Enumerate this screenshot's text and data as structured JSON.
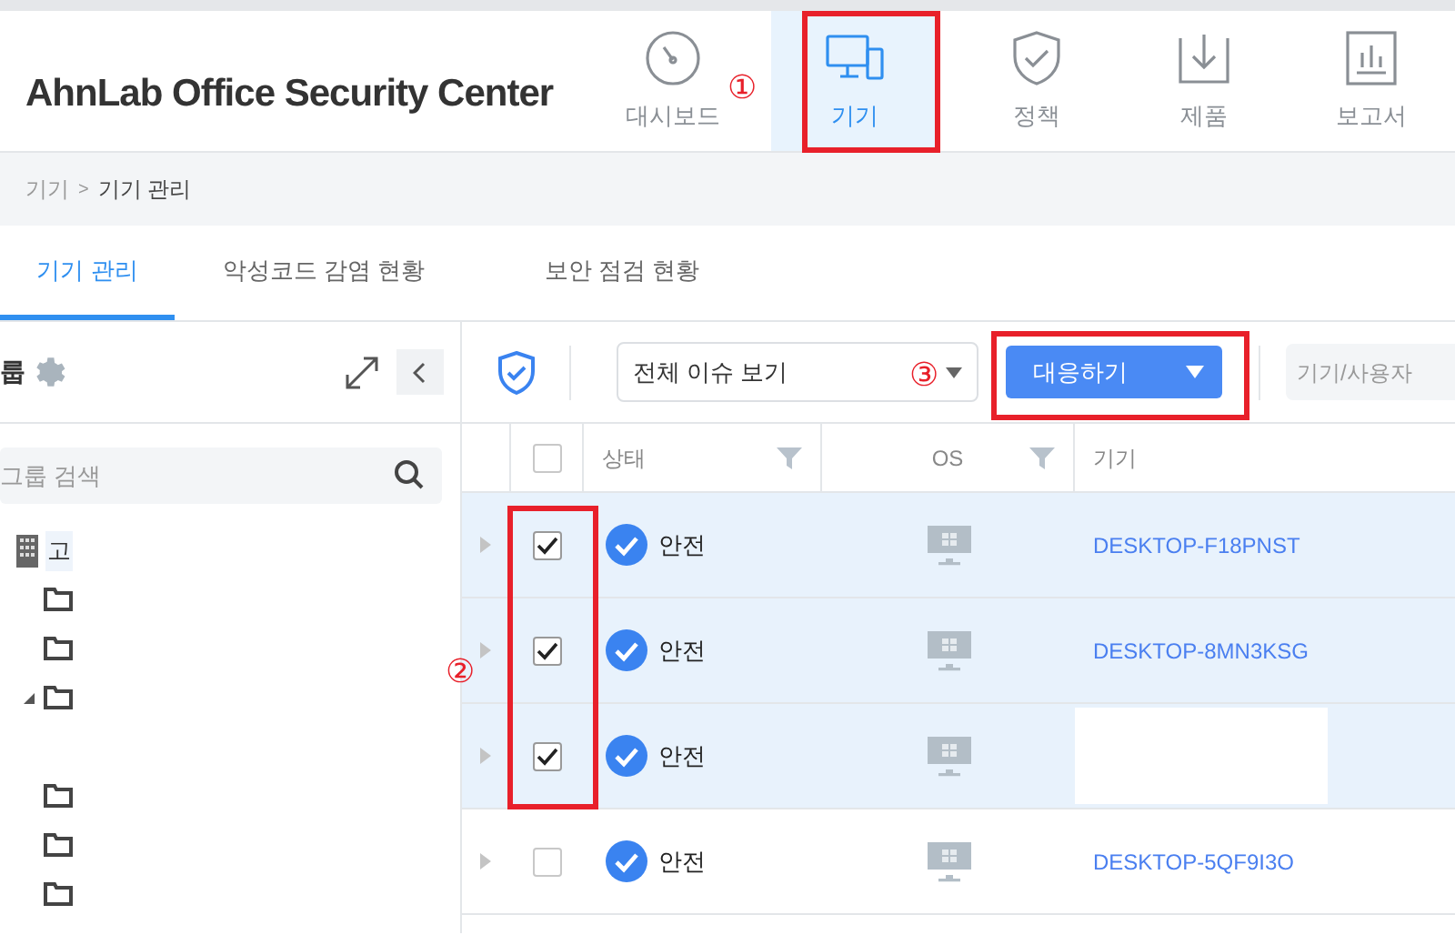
{
  "header": {
    "logo": "AhnLab Office Security Center",
    "nav": [
      {
        "label": "대시보드",
        "selected": false
      },
      {
        "label": "기기",
        "selected": true
      },
      {
        "label": "정책",
        "selected": false
      },
      {
        "label": "제품",
        "selected": false
      },
      {
        "label": "보고서",
        "selected": false
      }
    ]
  },
  "breadcrumb": {
    "items": [
      "기기",
      "기기 관리"
    ],
    "separator": ">"
  },
  "tabs": [
    {
      "label": "기기 관리",
      "selected": true
    },
    {
      "label": "악성코드 감염 현황",
      "selected": false
    },
    {
      "label": "보안 점검 현황",
      "selected": false
    }
  ],
  "sidebar": {
    "title": "룹",
    "search": {
      "placeholder": "그룹 검색"
    },
    "tree": [
      {
        "label": "고",
        "children": [
          {
            "expanded": false
          },
          {
            "expanded": false
          },
          {
            "expanded": true
          },
          {
            "expanded": false
          },
          {
            "expanded": false
          },
          {
            "expanded": false
          }
        ]
      }
    ]
  },
  "toolbar": {
    "filter": "전체 이슈 보기",
    "action": "대응하기",
    "search": {
      "placeholder": "기기/사용자"
    }
  },
  "table": {
    "select_all": {
      "checked": false
    },
    "columns": [
      {
        "label": "상태",
        "filter": true
      },
      {
        "label": "OS",
        "filter": true
      },
      {
        "label": "기기",
        "filter": false
      }
    ],
    "rows": [
      {
        "selected": true,
        "checked": true,
        "status": "안전",
        "redacted": false,
        "device": "DESKTOP-F18PNST"
      },
      {
        "selected": true,
        "checked": true,
        "status": "안전",
        "redacted": false,
        "device": "DESKTOP-8MN3KSG"
      },
      {
        "selected": true,
        "checked": true,
        "status": "안전",
        "redacted": true
      },
      {
        "selected": false,
        "checked": false,
        "status": "안전",
        "redacted": false,
        "device": "DESKTOP-5QF9I3O"
      }
    ]
  },
  "annotations": [
    {
      "label": "①"
    },
    {
      "label": "②"
    },
    {
      "label": "③"
    }
  ]
}
